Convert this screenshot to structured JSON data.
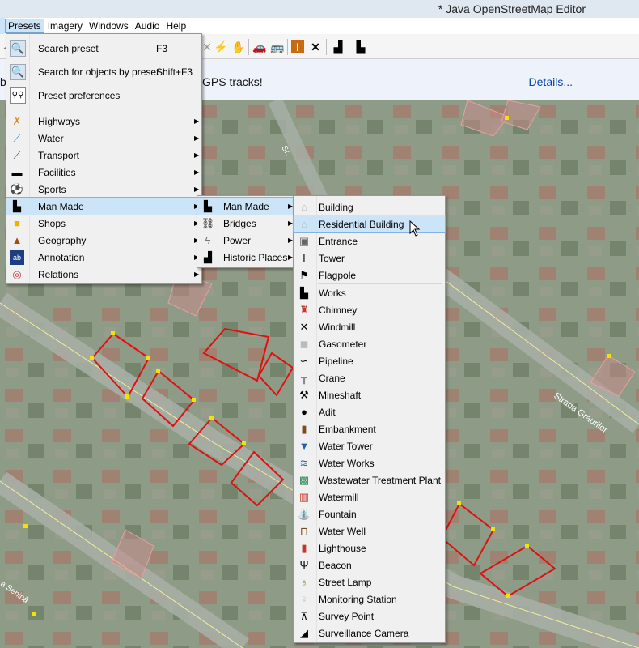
{
  "window": {
    "title": "* Java OpenStreetMap Editor"
  },
  "menubar": {
    "items": [
      "Presets",
      "Imagery",
      "Windows",
      "Audio",
      "Help"
    ]
  },
  "infobar": {
    "prefix": "b",
    "message": "GPS tracks!",
    "link": "Details..."
  },
  "map": {
    "street_label": "Strada Graurilor",
    "street_label_2": "Sr.",
    "street_label_3": "a Senină"
  },
  "presets_menu": {
    "top_items": [
      {
        "label": "Search preset",
        "shortcut": "F3",
        "icon": "search-preset-icon"
      },
      {
        "label": "Search for objects by preset",
        "shortcut": "Shift+F3",
        "icon": "search-objects-icon"
      },
      {
        "label": "Preset preferences",
        "shortcut": "",
        "icon": "preferences-icon"
      }
    ],
    "categories": [
      {
        "label": "Highways",
        "icon": "highway-icon"
      },
      {
        "label": "Water",
        "icon": "water-icon"
      },
      {
        "label": "Transport",
        "icon": "transport-icon"
      },
      {
        "label": "Facilities",
        "icon": "facilities-icon"
      },
      {
        "label": "Sports",
        "icon": "sports-icon"
      },
      {
        "label": "Man Made",
        "icon": "man-made-icon"
      },
      {
        "label": "Shops",
        "icon": "shops-icon"
      },
      {
        "label": "Geography",
        "icon": "geography-icon"
      },
      {
        "label": "Annotation",
        "icon": "annotation-icon"
      },
      {
        "label": "Relations",
        "icon": "relations-icon"
      }
    ]
  },
  "man_made_menu": {
    "items": [
      {
        "label": "Man Made",
        "icon": "factory-icon"
      },
      {
        "label": "Bridges",
        "icon": "bridge-icon"
      },
      {
        "label": "Power",
        "icon": "power-icon"
      },
      {
        "label": "Historic Places",
        "icon": "castle-icon"
      }
    ]
  },
  "man_made_sub": {
    "groups": [
      [
        "Building",
        "Residential Building",
        "Entrance",
        "Tower",
        "Flagpole"
      ],
      [
        "Works",
        "Chimney",
        "Windmill",
        "Gasometer",
        "Pipeline",
        "Crane",
        "Mineshaft",
        "Adit",
        "Embankment"
      ],
      [
        "Water Tower",
        "Water Works",
        "Wastewater Treatment Plant",
        "Watermill",
        "Fountain",
        "Water Well"
      ],
      [
        "Lighthouse",
        "Beacon",
        "Street Lamp",
        "Monitoring Station",
        "Survey Point",
        "Surveillance Camera"
      ]
    ],
    "highlighted": "Residential Building"
  }
}
